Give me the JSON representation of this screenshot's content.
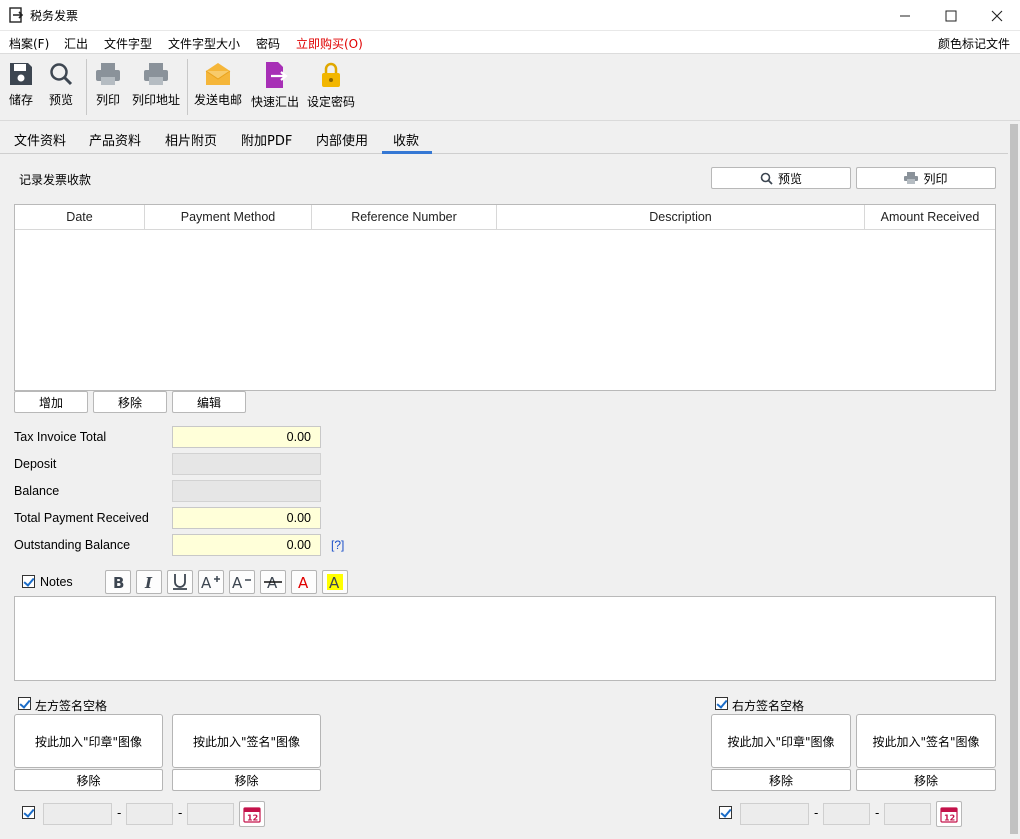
{
  "window": {
    "title": "税务发票",
    "minimize": "—",
    "maximize": "☐",
    "close": "✕"
  },
  "menu": {
    "items": [
      "档案(F)",
      "汇出",
      "文件字型",
      "文件字型大小",
      "密码",
      "立即购买(O)"
    ],
    "right": "颜色标记文件",
    "buy_color": "#e00000"
  },
  "toolbar": {
    "items": [
      "储存",
      "预览",
      "列印",
      "列印地址",
      "发送电邮",
      "快速汇出",
      "设定密码"
    ]
  },
  "tabs": {
    "items": [
      "文件资料",
      "产品资料",
      "相片附页",
      "附加PDF",
      "内部使用",
      "收款"
    ],
    "active": "收款"
  },
  "section": {
    "title": "记录发票收款",
    "preview_label": "预览",
    "print_label": "列印"
  },
  "table": {
    "columns": [
      "Date",
      "Payment Method",
      "Reference Number",
      "Description",
      "Amount Received"
    ],
    "rows": []
  },
  "row_actions": {
    "add": "增加",
    "remove": "移除",
    "edit": "编辑"
  },
  "totals": {
    "tax_invoice_total_label": "Tax Invoice Total",
    "tax_invoice_total": "0.00",
    "deposit_label": "Deposit",
    "deposit": "",
    "balance_label": "Balance",
    "balance": "",
    "total_payment_received_label": "Total Payment Received",
    "total_payment_received": "0.00",
    "outstanding_balance_label": "Outstanding Balance",
    "outstanding_balance": "0.00",
    "help_link": "[?]"
  },
  "notes": {
    "label": "Notes",
    "checked": true,
    "text": ""
  },
  "signature": {
    "left_label": "左方签名空格",
    "right_label": "右方签名空格",
    "add_stamp": "按此加入\"印章\"图像",
    "add_signature": "按此加入\"签名\"图像",
    "remove": "移除",
    "date_sep": "-"
  },
  "colors": {
    "accent": "#3578d4",
    "field_yellow": "#ffffd9",
    "envelope": "#f5b63a",
    "export": "#a72fb6",
    "lock": "#f2b600",
    "calendar": "#c4124a"
  }
}
